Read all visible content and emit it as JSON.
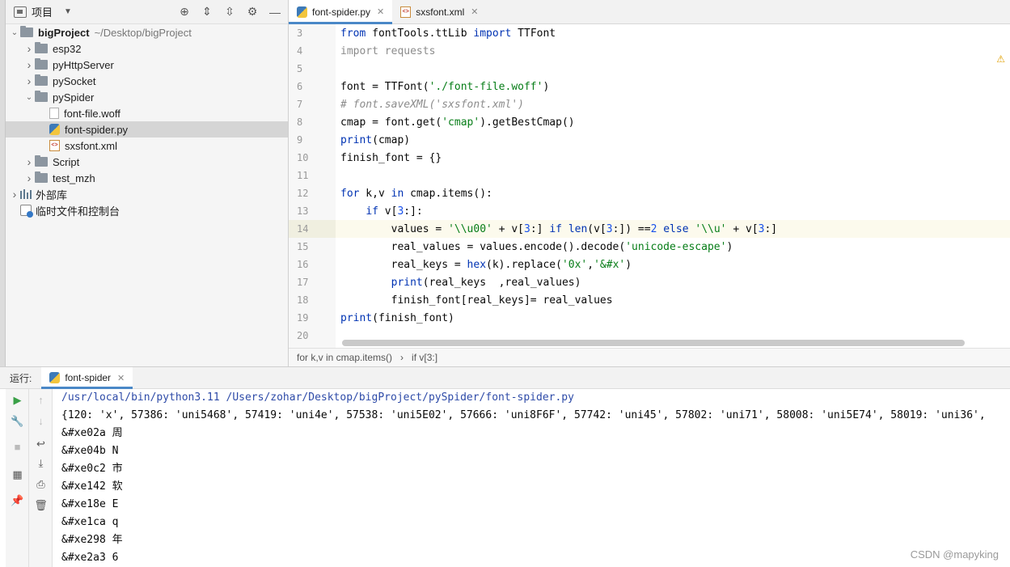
{
  "project": {
    "title": "项目",
    "tree": [
      {
        "label": "bigProject",
        "extra": "~/Desktop/bigProject",
        "type": "folder",
        "depth": 0,
        "expanded": true
      },
      {
        "label": "esp32",
        "type": "folder",
        "depth": 1,
        "expanded": false
      },
      {
        "label": "pyHttpServer",
        "type": "folder",
        "depth": 1,
        "expanded": false
      },
      {
        "label": "pySocket",
        "type": "folder",
        "depth": 1,
        "expanded": false
      },
      {
        "label": "pySpider",
        "type": "folder",
        "depth": 1,
        "expanded": true
      },
      {
        "label": "font-file.woff",
        "type": "file",
        "depth": 2
      },
      {
        "label": "font-spider.py",
        "type": "py",
        "depth": 2,
        "selected": true
      },
      {
        "label": "sxsfont.xml",
        "type": "xml",
        "depth": 2
      },
      {
        "label": "Script",
        "type": "folder",
        "depth": 1,
        "expanded": false
      },
      {
        "label": "test_mzh",
        "type": "folder",
        "depth": 1,
        "expanded": false
      },
      {
        "label": "外部库",
        "type": "lib",
        "depth": 0,
        "expanded": false
      },
      {
        "label": "临时文件和控制台",
        "type": "scratch",
        "depth": 0
      }
    ]
  },
  "editor": {
    "tabs": [
      {
        "label": "font-spider.py",
        "active": true
      },
      {
        "label": "sxsfont.xml",
        "active": false
      }
    ],
    "current_line": 14,
    "lines": [
      {
        "n": "3",
        "indent": "",
        "segs": [
          [
            "kw",
            "from"
          ],
          [
            "",
            " fontTools.ttLib "
          ],
          [
            "kw",
            "import"
          ],
          [
            "",
            " TTFont"
          ]
        ]
      },
      {
        "n": "4",
        "indent": "",
        "segs": [
          [
            "dim",
            "import requests"
          ]
        ]
      },
      {
        "n": "5",
        "indent": "",
        "segs": []
      },
      {
        "n": "6",
        "indent": "",
        "segs": [
          [
            "",
            "font = TTFont("
          ],
          [
            "str",
            "'./font-file.woff'"
          ],
          [
            "",
            ")"
          ]
        ]
      },
      {
        "n": "7",
        "indent": "",
        "segs": [
          [
            "cm",
            "# font.saveXML('sxsfont.xml')"
          ]
        ]
      },
      {
        "n": "8",
        "indent": "",
        "segs": [
          [
            "",
            "cmap = font.get("
          ],
          [
            "str",
            "'cmap'"
          ],
          [
            "",
            ").getBestCmap()"
          ]
        ]
      },
      {
        "n": "9",
        "indent": "",
        "segs": [
          [
            "kw",
            "print"
          ],
          [
            "",
            "(cmap)"
          ]
        ]
      },
      {
        "n": "10",
        "indent": "",
        "segs": [
          [
            "",
            "finish_font = {}"
          ]
        ]
      },
      {
        "n": "11",
        "indent": "",
        "segs": []
      },
      {
        "n": "12",
        "indent": "",
        "segs": [
          [
            "kw",
            "for"
          ],
          [
            "",
            " k,v "
          ],
          [
            "kw",
            "in"
          ],
          [
            "",
            " cmap.items():"
          ]
        ]
      },
      {
        "n": "13",
        "indent": "    ",
        "segs": [
          [
            "kw",
            "if"
          ],
          [
            "",
            " v["
          ],
          [
            "num",
            "3"
          ],
          [
            "",
            ":]:"
          ]
        ]
      },
      {
        "n": "14",
        "indent": "        ",
        "segs": [
          [
            "",
            "values = "
          ],
          [
            "str",
            "'\\\\u00'"
          ],
          [
            "",
            " + v["
          ],
          [
            "num",
            "3"
          ],
          [
            "",
            ":] "
          ],
          [
            "kw",
            "if"
          ],
          [
            "",
            " "
          ],
          [
            "kw",
            "len"
          ],
          [
            "",
            "(v["
          ],
          [
            "num",
            "3"
          ],
          [
            "",
            ":]) =="
          ],
          [
            "num",
            "2"
          ],
          [
            "",
            " "
          ],
          [
            "kw",
            "else"
          ],
          [
            "",
            " "
          ],
          [
            "str",
            "'\\\\u'"
          ],
          [
            "",
            " + v["
          ],
          [
            "num",
            "3"
          ],
          [
            "",
            ":]"
          ]
        ]
      },
      {
        "n": "15",
        "indent": "        ",
        "segs": [
          [
            "",
            "real_values = values.encode().decode("
          ],
          [
            "str",
            "'unicode-escape'"
          ],
          [
            "",
            ")"
          ]
        ]
      },
      {
        "n": "16",
        "indent": "        ",
        "segs": [
          [
            "",
            "real_keys = "
          ],
          [
            "kw",
            "hex"
          ],
          [
            "",
            "(k).replace("
          ],
          [
            "str",
            "'0x'"
          ],
          [
            "",
            ","
          ],
          [
            "str",
            "'&#x'"
          ],
          [
            "",
            ")"
          ]
        ]
      },
      {
        "n": "17",
        "indent": "        ",
        "segs": [
          [
            "kw",
            "print"
          ],
          [
            "",
            "(real_keys  ,real_values)"
          ]
        ]
      },
      {
        "n": "18",
        "indent": "        ",
        "segs": [
          [
            "",
            "finish_font[real_keys]= real_values"
          ]
        ]
      },
      {
        "n": "19",
        "indent": "",
        "segs": [
          [
            "kw",
            "print"
          ],
          [
            "",
            "(finish_font)"
          ]
        ]
      },
      {
        "n": "20",
        "indent": "",
        "segs": []
      }
    ],
    "breadcrumb": [
      "for k,v in cmap.items()",
      "if v[3:]"
    ]
  },
  "run": {
    "label": "运行:",
    "tab": "font-spider",
    "output": [
      "/usr/local/bin/python3.11 /Users/zohar/Desktop/bigProject/pySpider/font-spider.py",
      "{120: 'x', 57386: 'uni5468', 57419: 'uni4e', 57538: 'uni5E02', 57666: 'uni8F6F', 57742: 'uni45', 57802: 'uni71', 58008: 'uni5E74', 58019: 'uni36',",
      "&#xe02a 周",
      "&#xe04b N",
      "&#xe0c2 市",
      "&#xe142 软",
      "&#xe18e E",
      "&#xe1ca q",
      "&#xe298 年",
      "&#xe2a3 6"
    ]
  },
  "watermark": "CSDN @mapyking"
}
